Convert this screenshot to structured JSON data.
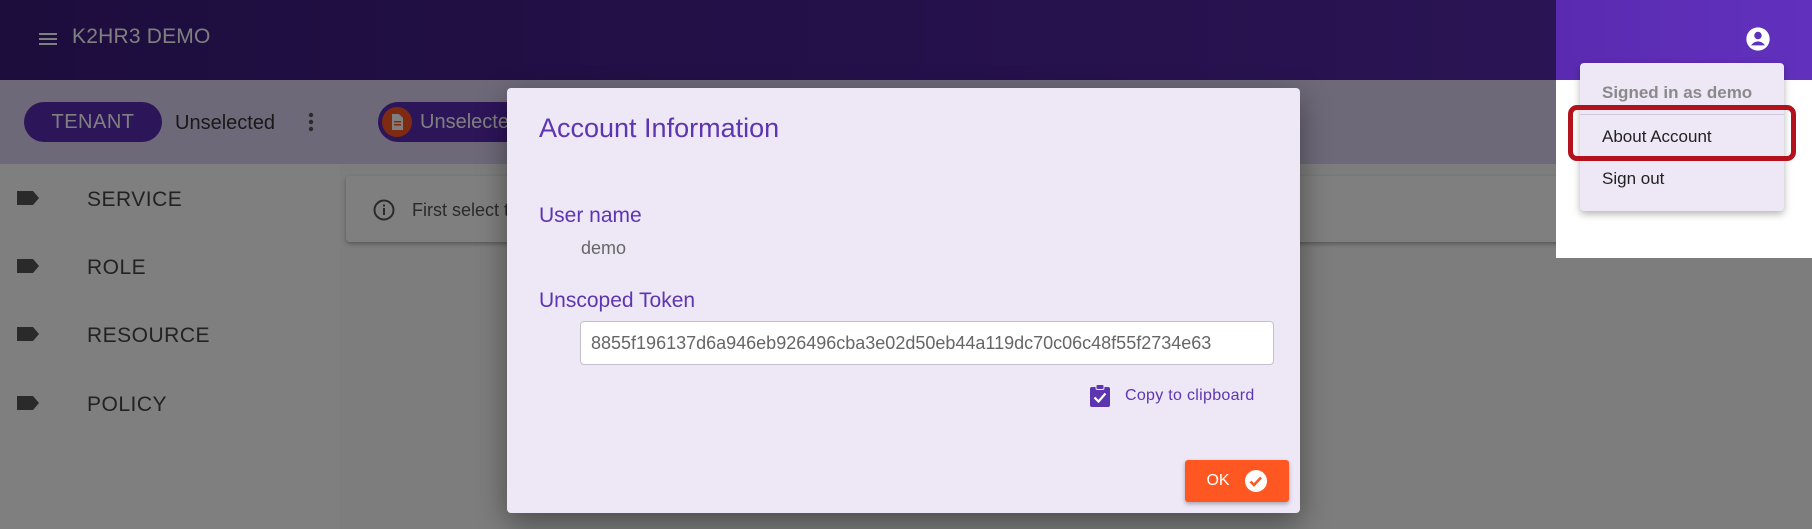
{
  "appbar": {
    "title": "K2HR3 DEMO"
  },
  "toolbar": {
    "tenant_label": "TENANT",
    "tenant_value": "Unselected",
    "service_label": "Unselected"
  },
  "sidebar": {
    "items": [
      {
        "label": "SERVICE"
      },
      {
        "label": "ROLE"
      },
      {
        "label": "RESOURCE"
      },
      {
        "label": "POLICY"
      }
    ]
  },
  "content": {
    "info_text": "First select t"
  },
  "dialog": {
    "title": "Account Information",
    "user_name_label": "User name",
    "user_name_value": "demo",
    "token_label": "Unscoped Token",
    "token_value": "8855f196137d6a946eb926496cba3e02d50eb44a119dc70c06c48f55f2734e63",
    "copy_label": "Copy to clipboard",
    "ok_label": "OK"
  },
  "account_menu": {
    "signed_in": "Signed in as demo",
    "about": "About Account",
    "sign_out": "Sign out"
  },
  "colors": {
    "primary": "#5b2bb3",
    "accent": "#ff5722",
    "dialog_bg": "#ede7f6",
    "highlight": "#b3121c"
  },
  "icons": {
    "menu": "hamburger-icon",
    "account": "account-circle-icon",
    "kebab": "more-vert-icon",
    "document": "document-icon",
    "tag": "label-tag-icon",
    "info": "info-icon",
    "clipboard": "clipboard-check-icon",
    "check": "check-circle-icon"
  }
}
